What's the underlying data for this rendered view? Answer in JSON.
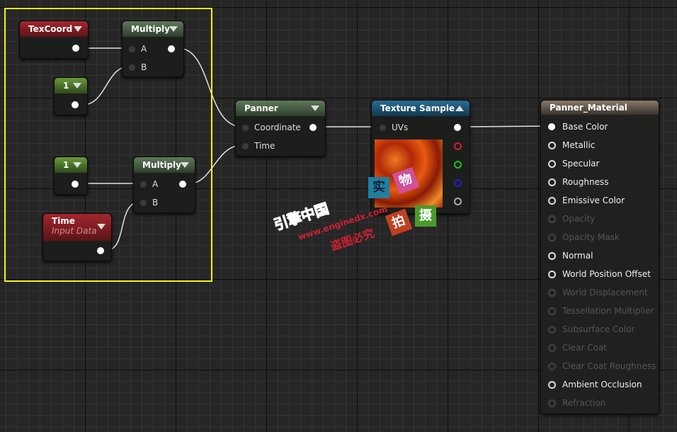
{
  "nodes": {
    "texcoord": {
      "title": "TexCoord"
    },
    "multiply1": {
      "title": "Multiply",
      "pins": [
        "A",
        "B"
      ]
    },
    "const1": {
      "title": "1"
    },
    "const2": {
      "title": "1"
    },
    "multiply2": {
      "title": "Multiply",
      "pins": [
        "A",
        "B"
      ]
    },
    "time": {
      "title": "Time",
      "subtitle": "Input Data"
    },
    "panner": {
      "title": "Panner",
      "pins": [
        "Coordinate",
        "Time"
      ]
    },
    "texture_sample": {
      "title": "Texture Sample",
      "pins": [
        "UVs"
      ],
      "output_colors": [
        "#ffffff",
        "#d0202a",
        "#20c020",
        "#2020d0",
        "#aaaaaa"
      ]
    },
    "material": {
      "title": "Panner_Material",
      "inputs": [
        {
          "label": "Base Color",
          "connected": true,
          "enabled": true
        },
        {
          "label": "Metallic",
          "enabled": true
        },
        {
          "label": "Specular",
          "enabled": true
        },
        {
          "label": "Roughness",
          "enabled": true
        },
        {
          "label": "Emissive Color",
          "enabled": true
        },
        {
          "label": "Opacity",
          "enabled": false
        },
        {
          "label": "Opacity Mask",
          "enabled": false
        },
        {
          "label": "Normal",
          "enabled": true
        },
        {
          "label": "World Position Offset",
          "enabled": true
        },
        {
          "label": "World Displacement",
          "enabled": false
        },
        {
          "label": "Tessellation Multiplier",
          "enabled": false
        },
        {
          "label": "Subsurface Color",
          "enabled": false
        },
        {
          "label": "Clear Coat",
          "enabled": false
        },
        {
          "label": "Clear Coat Roughness",
          "enabled": false
        },
        {
          "label": "Ambient Occlusion",
          "enabled": true
        },
        {
          "label": "Refraction",
          "enabled": false
        }
      ]
    }
  },
  "watermark": {
    "line1": "引擎中国",
    "line2": "www.enginedx.com",
    "line3": "盗图必究",
    "tags": [
      "实",
      "物",
      "拍",
      "摄"
    ]
  },
  "colors": {
    "selection": "#f4ef1a",
    "wire": "#e0e0e0"
  }
}
